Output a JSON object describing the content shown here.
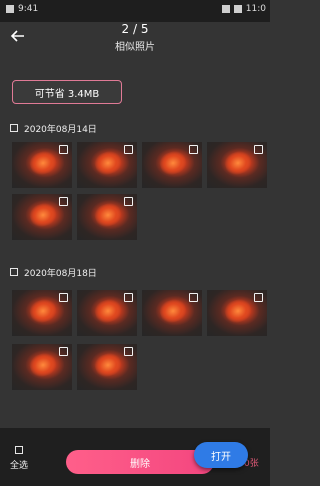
{
  "status_bar": {
    "time_left": "9:41",
    "time_right": "11:0"
  },
  "header": {
    "counter": "2 / 5",
    "title": "相似照片",
    "back_icon": "back-arrow-icon"
  },
  "savings": {
    "label": "可节省 3.4MB"
  },
  "groups": [
    {
      "date": "2020年08月14日",
      "photo_count": 6
    },
    {
      "date": "2020年08月18日",
      "photo_count": 6
    }
  ],
  "bottom": {
    "select_all": "全选",
    "delete": "删除",
    "open": "打开",
    "tail": "0张"
  },
  "colors": {
    "accent": "#f3467f",
    "open_button": "#2f7be6",
    "background": "#343434"
  }
}
